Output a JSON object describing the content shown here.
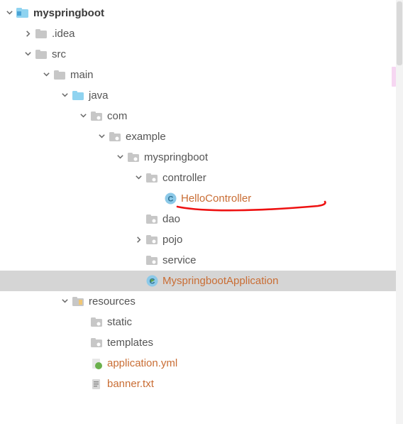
{
  "tree": {
    "root": "myspringboot",
    "idea": ".idea",
    "src": "src",
    "main": "main",
    "java": "java",
    "com": "com",
    "example": "example",
    "pkg": "myspringboot",
    "controller": "controller",
    "hello": "HelloController",
    "dao": "dao",
    "pojo": "pojo",
    "service": "service",
    "app": "MyspringbootApplication",
    "resources": "resources",
    "static": "static",
    "templates": "templates",
    "appyml": "application.yml",
    "banner": "banner.txt"
  }
}
